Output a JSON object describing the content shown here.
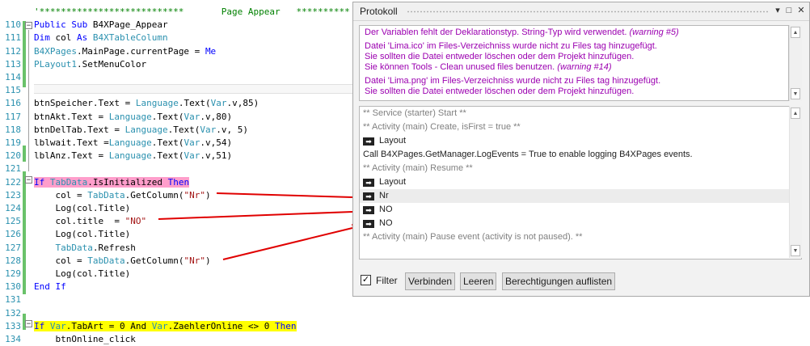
{
  "editor": {
    "lines": [
      {
        "n": "",
        "t": "'***************************       Page Appear   **********"
      },
      {
        "n": "110",
        "t": "Public Sub B4XPage_Appear"
      },
      {
        "n": "111",
        "t": "Dim col As B4XTableColumn"
      },
      {
        "n": "112",
        "t": "B4XPages.MainPage.currentPage = Me"
      },
      {
        "n": "113",
        "t": "PLayout1.SetMenuColor"
      },
      {
        "n": "114",
        "t": ""
      },
      {
        "n": "115",
        "t": ""
      },
      {
        "n": "116",
        "t": "btnSpeicher.Text = Language.Text(Var.v,85)"
      },
      {
        "n": "117",
        "t": "btnAkt.Text = Language.Text(Var.v,80)"
      },
      {
        "n": "118",
        "t": "btnDelTab.Text = Language.Text(Var.v, 5)"
      },
      {
        "n": "119",
        "t": "lblwait.Text =Language.Text(Var.v,54)"
      },
      {
        "n": "120",
        "t": "lblAnz.Text = Language.Text(Var.v,51)"
      },
      {
        "n": "121",
        "t": ""
      },
      {
        "n": "122",
        "t": "If TabData.IsInitialized Then"
      },
      {
        "n": "123",
        "t": "    col = TabData.GetColumn(\"Nr\")"
      },
      {
        "n": "124",
        "t": "    Log(col.Title)"
      },
      {
        "n": "125",
        "t": "    col.title  = \"NO\""
      },
      {
        "n": "126",
        "t": "    Log(col.Title)"
      },
      {
        "n": "127",
        "t": "    TabData.Refresh"
      },
      {
        "n": "128",
        "t": "    col = TabData.GetColumn(\"Nr\")"
      },
      {
        "n": "129",
        "t": "    Log(col.Title)"
      },
      {
        "n": "130",
        "t": "End If"
      },
      {
        "n": "131",
        "t": ""
      },
      {
        "n": "132",
        "t": ""
      },
      {
        "n": "133",
        "t": "If Var.TabArt = 0 And Var.ZaehlerOnline <> 0 Then"
      },
      {
        "n": "134",
        "t": "    btnOnline_click"
      }
    ]
  },
  "panel": {
    "title": "Protokoll",
    "controls": {
      "dropdown": "▾",
      "maximize": "□",
      "close": "✕"
    },
    "warnings": [
      {
        "text": "Der Variablen fehlt der Deklarationstyp. String-Typ wird verwendet.",
        "code": "(warning #5)"
      },
      {
        "text": "Datei 'Lima.ico' im Files-Verzeichniss wurde nicht zu Files tag hinzugefügt.\nSie sollten die Datei entweder löschen oder dem Projekt hinzufügen.\nSie können Tools - Clean unused files benutzen.",
        "code": "(warning #14)"
      },
      {
        "text": "Datei 'Lima.png' im Files-Verzeichniss wurde nicht zu Files tag hinzugefügt.\nSie sollten die Datei entweder löschen oder dem Projekt hinzufügen.",
        "code": ""
      }
    ],
    "log": [
      {
        "text": "** Service (starter) Start **",
        "style": "gray",
        "icon": false
      },
      {
        "text": "** Activity (main) Create, isFirst = true **",
        "style": "gray",
        "icon": false
      },
      {
        "text": "Layout",
        "style": "normal",
        "icon": true
      },
      {
        "text": "Call B4XPages.GetManager.LogEvents = True to enable logging B4XPages events.",
        "style": "normal",
        "icon": false
      },
      {
        "text": "** Activity (main) Resume **",
        "style": "gray",
        "icon": false
      },
      {
        "text": "Layout",
        "style": "normal",
        "icon": true
      },
      {
        "text": "Nr",
        "style": "sel",
        "icon": true
      },
      {
        "text": "NO",
        "style": "normal",
        "icon": true
      },
      {
        "text": "NO",
        "style": "normal",
        "icon": true
      },
      {
        "text": "** Activity (main) Pause event (activity is not paused). **",
        "style": "gray",
        "icon": false
      }
    ],
    "filter_label": "Filter",
    "filter_checked": true,
    "buttons": {
      "connect": "Verbinden",
      "clear": "Leeren",
      "permissions": "Berechtigungen auflisten"
    }
  }
}
